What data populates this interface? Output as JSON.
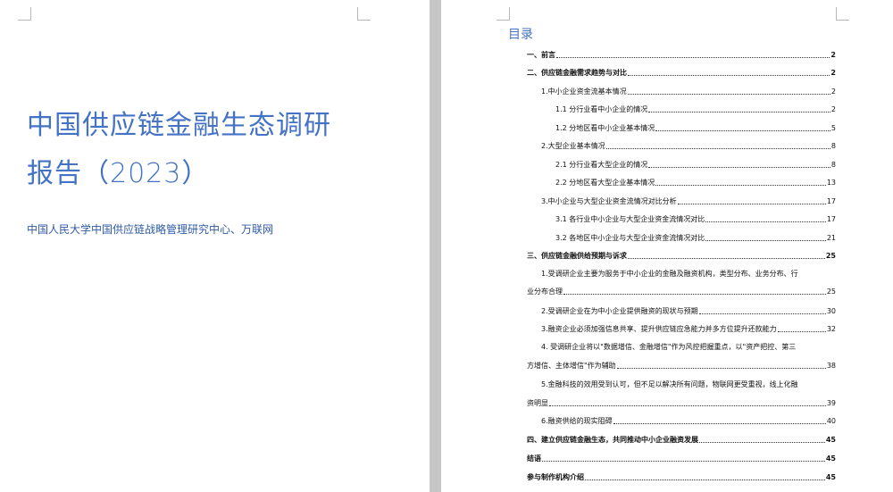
{
  "cover": {
    "title_line1": "中国供应链金融生态调研",
    "title_line2": "报告（2023）",
    "author": "中国人民大学中国供应链战略管理研究中心、万联网"
  },
  "toc": {
    "heading": "目录",
    "entries": [
      {
        "text": "一、前言",
        "page": "2"
      },
      {
        "text": "二、供应链金融需求趋势与对比",
        "page": "2"
      },
      {
        "text": "1.中小企业资金流基本情况",
        "page": "2"
      },
      {
        "text": "1.1 分行业看中小企业的情况",
        "page": "2"
      },
      {
        "text": "1.2 分地区看中小企业基本情况",
        "page": "5"
      },
      {
        "text": "2.大型企业基本情况",
        "page": "8"
      },
      {
        "text": "2.1 分行业看大型企业的情况",
        "page": "8"
      },
      {
        "text": "2.2 分地区看大型企业基本情况",
        "page": "13"
      },
      {
        "text": "3.中小企业与大型企业资金流情况对比分析",
        "page": "17"
      },
      {
        "text": "3.1 各行业中小企业与大型企业资金流情况对比",
        "page": "17"
      },
      {
        "text": "3.2 各地区中小企业与大型企业资金流情况对比",
        "page": "21"
      },
      {
        "text": "三、供应链金融供给预期与诉求",
        "page": "25"
      },
      {
        "text_line1": "1.受调研企业主要为服务于中小企业的金融及融资机构，类型分布、业务分布、行",
        "text_line2": "业分布合理",
        "page": "25"
      },
      {
        "text": "2.受调研企业在为中小企业提供融资的现状与预期",
        "page": "30"
      },
      {
        "text": "3.融资企业必须加强信息共享、提升供应链应急能力并多方位提升还款能力",
        "page": "32"
      },
      {
        "text_line1": "4. 受调研企业将以\"数据增信、金融增信\"作为风控把握重点，以\"资产把控、第三",
        "text_line2": "方增信、主体增信\"作为辅助",
        "page": "38"
      },
      {
        "text_line1": "5.金融科技的效用受到认可，但不足以解决所有问题，物联网更受重视，线上化融",
        "text_line2": "资明显",
        "page": "39"
      },
      {
        "text": "6.融资供给的现实阻碍",
        "page": "40"
      },
      {
        "text": "四、建立供应链金融生态，共同推动中小企业融资发展",
        "page": "45"
      },
      {
        "text": "结语",
        "page": "45"
      },
      {
        "text": "参与制作机构介绍",
        "page": "45"
      }
    ]
  }
}
